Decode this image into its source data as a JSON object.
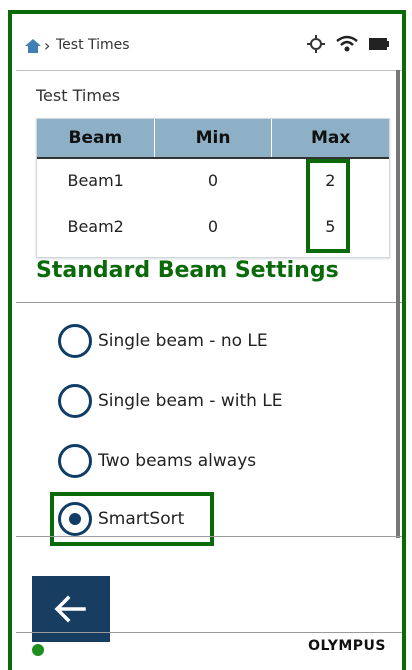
{
  "breadcrumb": {
    "label": "Test Times"
  },
  "section": {
    "title": "Test Times"
  },
  "table": {
    "headers": [
      "Beam",
      "Min",
      "Max"
    ],
    "rows": [
      {
        "beam": "Beam1",
        "min": "0",
        "max": "2"
      },
      {
        "beam": "Beam2",
        "min": "0",
        "max": "5"
      }
    ]
  },
  "settings": {
    "title": "Standard Beam Settings",
    "options": [
      {
        "label": "Single beam - no LE",
        "selected": false
      },
      {
        "label": "Single beam - with LE",
        "selected": false
      },
      {
        "label": "Two beams always",
        "selected": false
      },
      {
        "label": "SmartSort",
        "selected": true
      }
    ]
  },
  "footer": {
    "brand": "OLYMPUS"
  },
  "colors": {
    "highlight": "#0a6a0a",
    "navy": "#0f3d66",
    "table_header": "#8db0c6",
    "status_dot": "#1e8f1e"
  },
  "icons": [
    "home-icon",
    "chevron-right-icon",
    "gps-icon",
    "wifi-icon",
    "battery-icon",
    "back-arrow-icon"
  ]
}
